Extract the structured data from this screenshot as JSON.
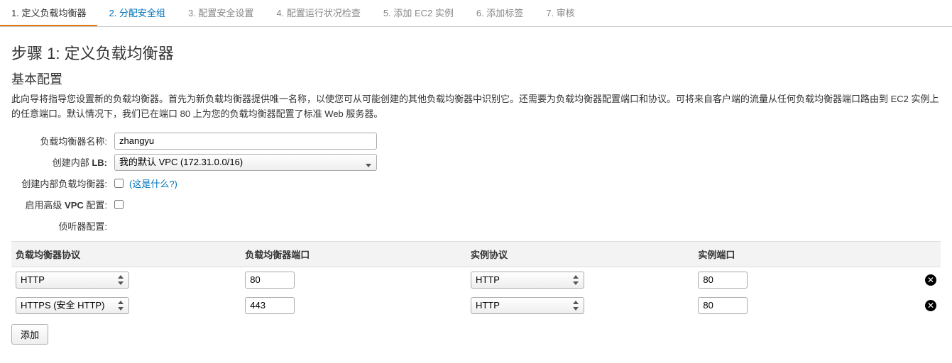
{
  "wizard": {
    "steps": [
      {
        "label": "1. 定义负载均衡器",
        "state": "active"
      },
      {
        "label": "2. 分配安全组",
        "state": "link"
      },
      {
        "label": "3. 配置安全设置",
        "state": ""
      },
      {
        "label": "4. 配置运行状况检查",
        "state": ""
      },
      {
        "label": "5. 添加 EC2 实例",
        "state": ""
      },
      {
        "label": "6. 添加标签",
        "state": ""
      },
      {
        "label": "7. 审核",
        "state": ""
      }
    ]
  },
  "page": {
    "title": "步骤 1: 定义负载均衡器",
    "section_title": "基本配置",
    "description": "此向导将指导您设置新的负载均衡器。首先为新负载均衡器提供唯一名称，以使您可从可能创建的其他负载均衡器中识别它。还需要为负载均衡器配置端口和协议。可将来自客户端的流量从任何负载均衡器端口路由到 EC2 实例上的任意端口。默认情况下，我们已在端口 80 上为您的负载均衡器配置了标准 Web 服务器。"
  },
  "form": {
    "name_label": "负载均衡器名称:",
    "name_value": "zhangyu",
    "create_in_label_prefix": "创建内部 ",
    "create_in_bold": "LB:",
    "vpc_value": "我的默认 VPC (172.31.0.0/16)",
    "internal_label": "创建内部负载均衡器:",
    "internal_help": "(这是什么?)",
    "adv_vpc_label_prefix": "启用高级 ",
    "adv_vpc_bold_part": "VPC",
    "adv_vpc_label_suffix": " 配置:",
    "listener_label": "侦听器配置:"
  },
  "listener": {
    "cols": {
      "lb_proto": "负载均衡器协议",
      "lb_port": "负载均衡器端口",
      "inst_proto": "实例协议",
      "inst_port": "实例端口"
    },
    "rows": [
      {
        "lb_proto": "HTTP",
        "lb_port": "80",
        "inst_proto": "HTTP",
        "inst_port": "80"
      },
      {
        "lb_proto": "HTTPS (安全 HTTP)",
        "lb_port": "443",
        "inst_proto": "HTTP",
        "inst_port": "80"
      }
    ],
    "add_label": "添加"
  }
}
